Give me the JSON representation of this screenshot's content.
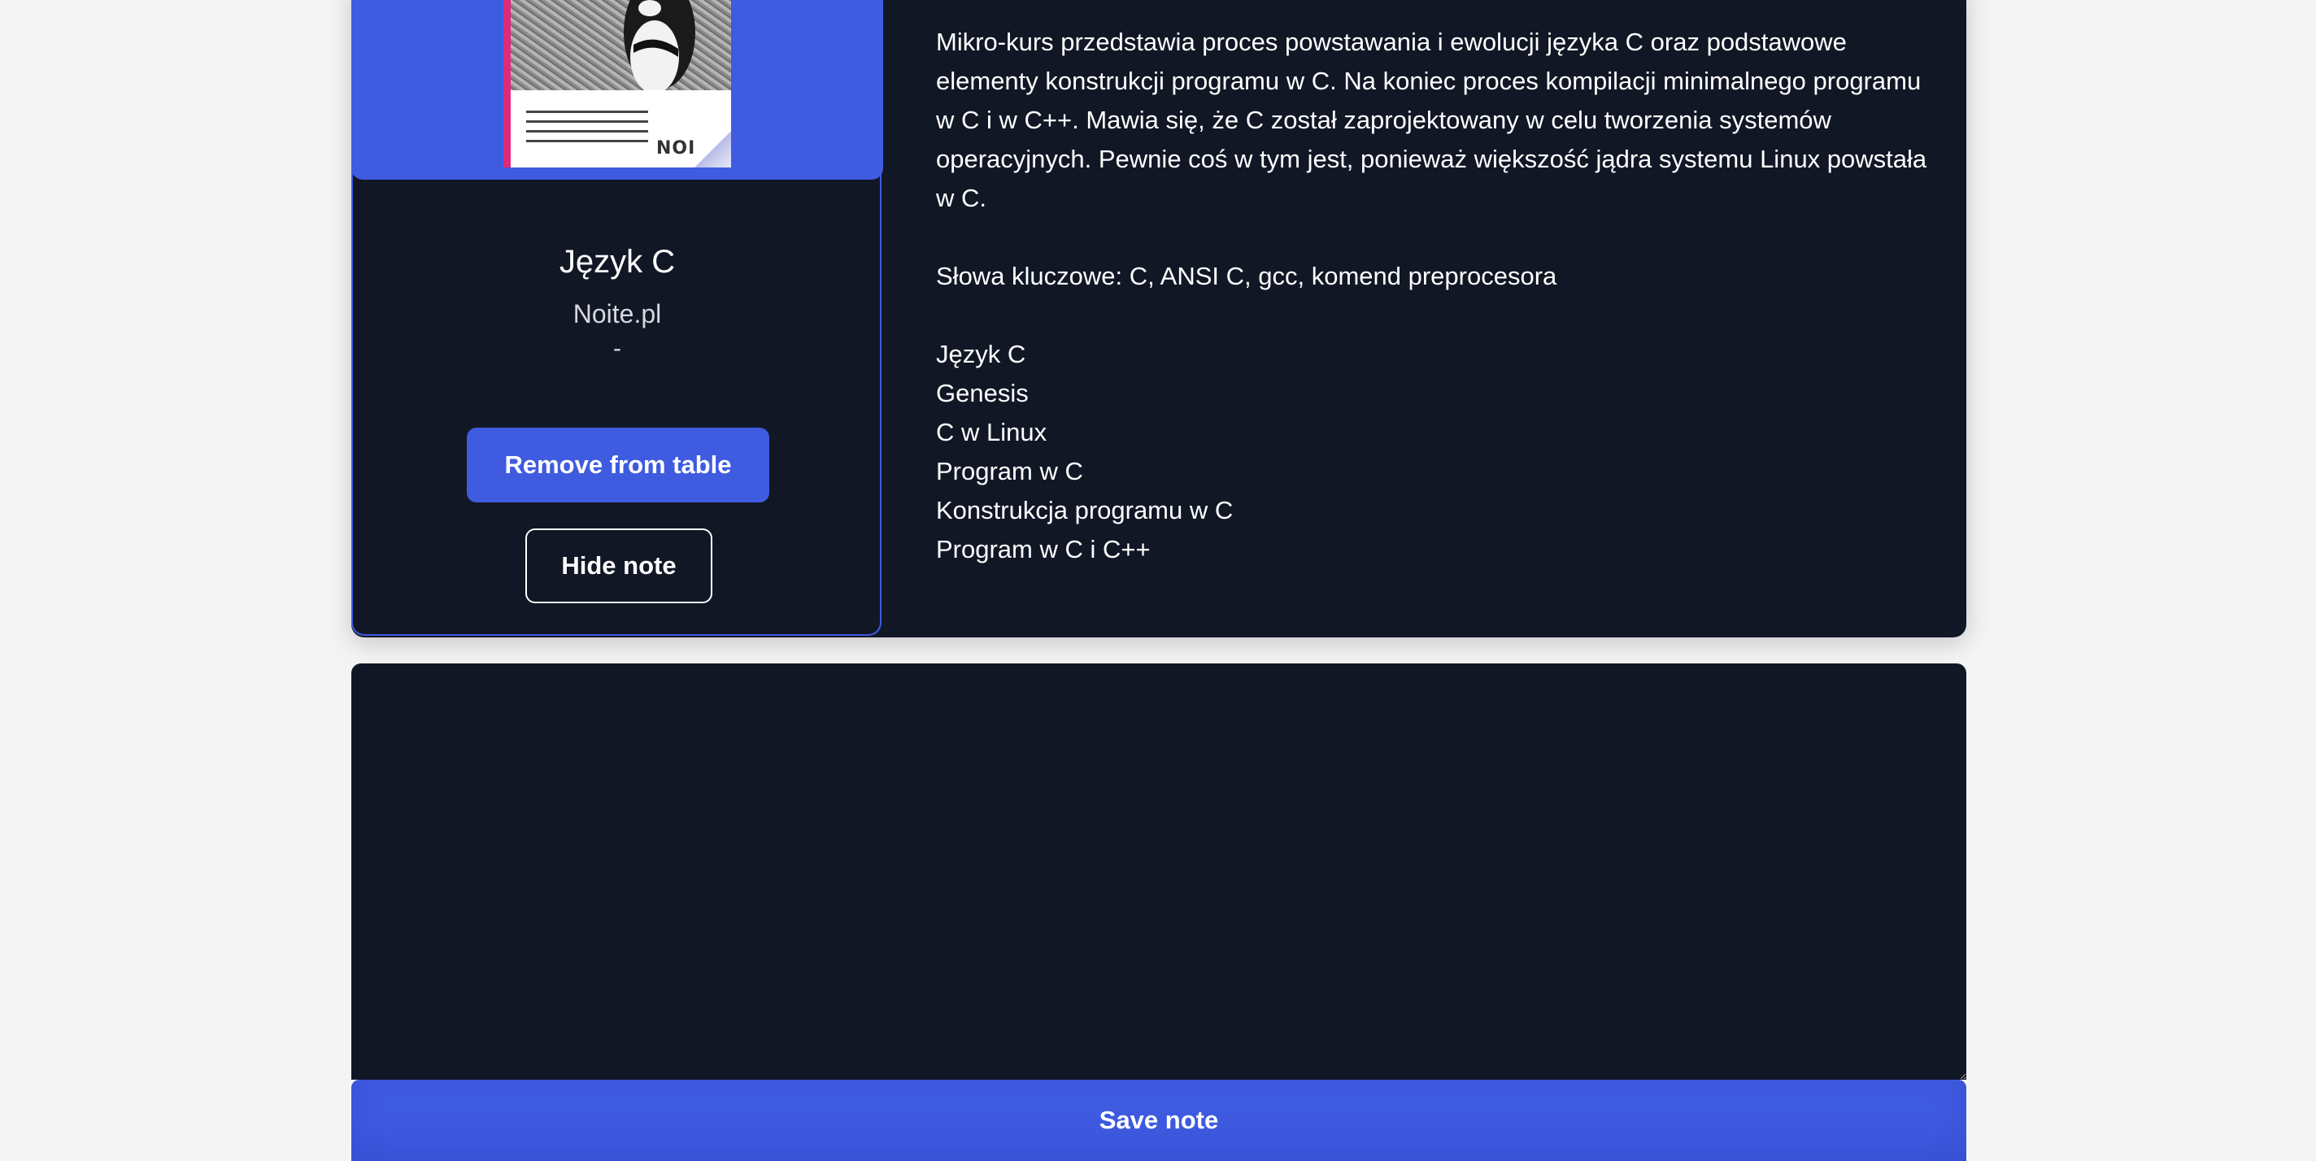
{
  "book": {
    "title": "Język C",
    "author": "Noite.pl",
    "extra": "-",
    "cover": {
      "logo_text": "NOIT",
      "accent_color": "#e0297c"
    }
  },
  "actions": {
    "remove_label": "Remove from table",
    "hide_note_label": "Hide note",
    "save_note_label": "Save note"
  },
  "description": {
    "summary": "Mikro-kurs przedstawia proces powstawania i ewolucji języka C oraz podstawowe elementy konstrukcji programu w C. Na koniec proces kompilacji minimalnego programu w C i w C++. Mawia się, że C został zaprojektowany w celu tworzenia systemów operacyjnych. Pewnie coś w tym jest, ponieważ większość jądra systemu Linux powstała w C.",
    "keywords": "Słowa kluczowe: C, ANSI C, gcc, komend preprocesora",
    "chapters": [
      "Język C",
      "Genesis",
      "C w Linux",
      "Program w C",
      "Konstrukcja programu w C",
      "Program w C i C++"
    ]
  },
  "note": {
    "value": "",
    "placeholder": ""
  },
  "colors": {
    "accent": "#3f5be0",
    "card_bg": "#121726",
    "page_bg": "#f4f4f5"
  }
}
